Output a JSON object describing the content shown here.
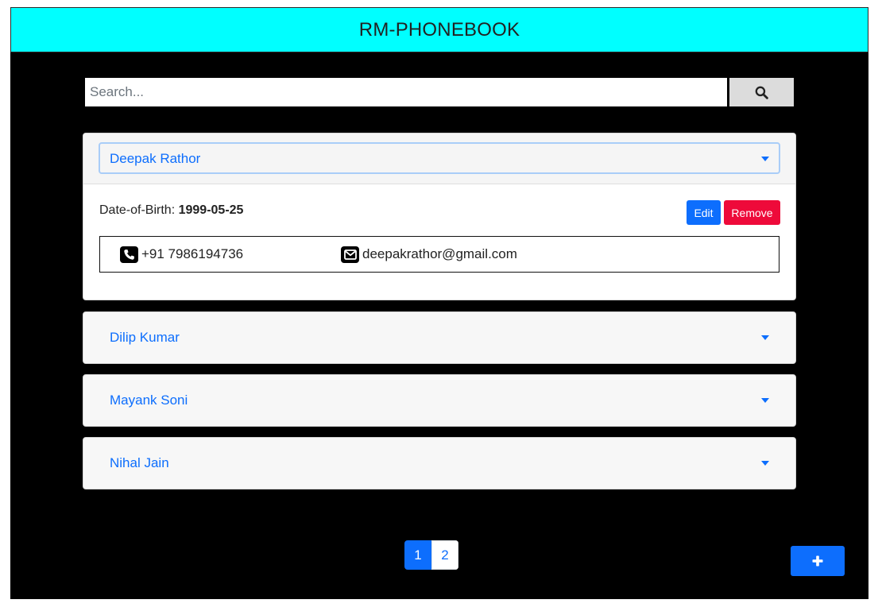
{
  "app": {
    "title": "RM-PHONEBOOK"
  },
  "search": {
    "placeholder": "Search...",
    "value": "",
    "button_icon": "search-icon"
  },
  "contacts": [
    {
      "name": "Deepak Rathor",
      "expanded": true,
      "dob_label": "Date-of-Birth:",
      "dob": "1999-05-25",
      "phone": "+91 7986194736",
      "email": "deepakrathor@gmail.com",
      "edit_label": "Edit",
      "remove_label": "Remove"
    },
    {
      "name": "Dilip Kumar",
      "expanded": false
    },
    {
      "name": "Mayank Soni",
      "expanded": false
    },
    {
      "name": "Nihal Jain",
      "expanded": false
    }
  ],
  "pagination": {
    "pages": [
      "1",
      "2"
    ],
    "current": "1"
  },
  "add_button": {
    "icon": "plus-icon"
  },
  "colors": {
    "header": "#00ffff",
    "background": "#000000",
    "accent": "#0d6efd",
    "danger": "#ee0a3a"
  }
}
